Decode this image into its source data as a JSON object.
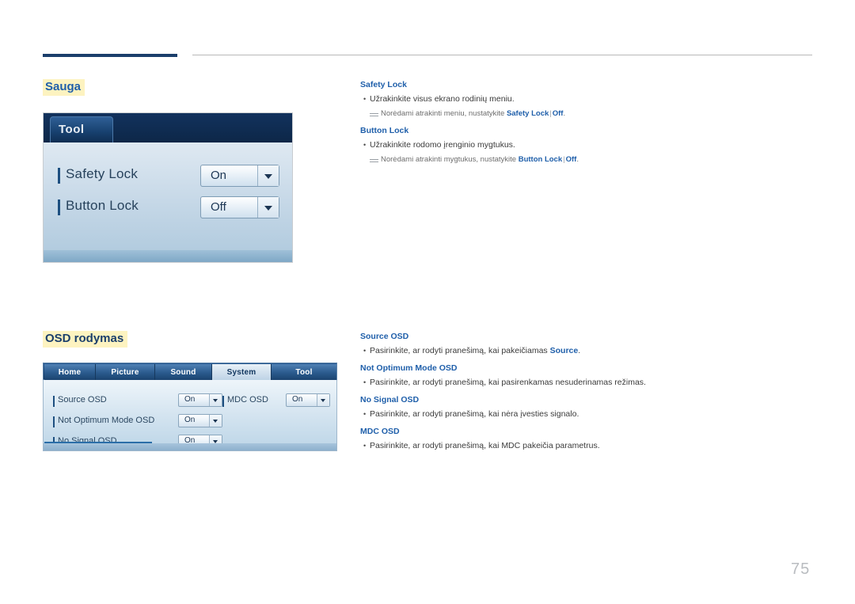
{
  "page": {
    "number": "75"
  },
  "sections": [
    {
      "id": "sauga",
      "title": "Sauga"
    },
    {
      "id": "osd",
      "title": "OSD rodymas"
    }
  ],
  "screenshot_tool": {
    "tab_label": "Tool",
    "rows": [
      {
        "label": "Safety Lock",
        "value": "On"
      },
      {
        "label": "Button Lock",
        "value": "Off"
      }
    ]
  },
  "screenshot_osd": {
    "tabs": [
      {
        "label": "Home",
        "active": false
      },
      {
        "label": "Picture",
        "active": false
      },
      {
        "label": "Sound",
        "active": false
      },
      {
        "label": "System",
        "active": true
      },
      {
        "label": "Tool",
        "active": false
      }
    ],
    "rows_left": [
      {
        "label": "Source OSD",
        "value": "On"
      },
      {
        "label": "Not Optimum Mode OSD",
        "value": "On"
      },
      {
        "label": "No Signal OSD",
        "value": "On"
      }
    ],
    "rows_right": [
      {
        "label": "MDC OSD",
        "value": "On"
      }
    ]
  },
  "descriptions": {
    "bullet_char": "•",
    "safety_lock": {
      "heading": "Safety Lock",
      "bullet": "Užrakinkite visus ekrano rodinių meniu.",
      "note_prefix": "Norėdami atrakinti meniu, nustatykite",
      "note_kw1": "Safety Lock",
      "note_sep": "|",
      "note_kw2": "Off",
      "note_suffix": "."
    },
    "button_lock": {
      "heading": "Button Lock",
      "bullet": "Užrakinkite rodomo įrenginio mygtukus.",
      "note_prefix": "Norėdami atrakinti mygtukus, nustatykite",
      "note_kw1": "Button Lock",
      "note_sep": "|",
      "note_kw2": "Off",
      "note_suffix": "."
    },
    "source_osd": {
      "heading": "Source OSD",
      "bullet_pre": "Pasirinkite, ar rodyti pranešimą, kai pakeičiamas",
      "bullet_kw": "Source",
      "bullet_post": "."
    },
    "not_optimum": {
      "heading": "Not Optimum Mode OSD",
      "bullet": "Pasirinkite, ar rodyti pranešimą, kai pasirenkamas nesuderinamas režimas."
    },
    "no_signal": {
      "heading": "No Signal OSD",
      "bullet": "Pasirinkite, ar rodyti pranešimą, kai nėra įvesties signalo."
    },
    "mdc_osd": {
      "heading": "MDC OSD",
      "bullet": "Pasirinkite, ar rodyti pranešimą, kai MDC pakeičia parametrus."
    }
  }
}
